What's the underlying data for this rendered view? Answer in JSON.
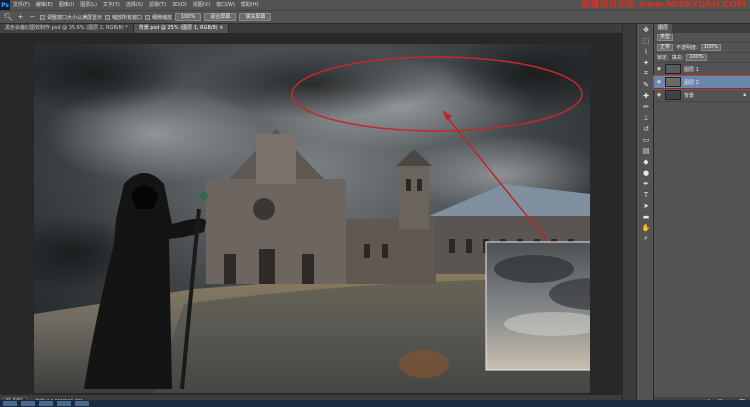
{
  "app": {
    "logo": "Ps"
  },
  "menu": [
    "文件(F)",
    "编辑(E)",
    "图像(I)",
    "图层(L)",
    "文字(Y)",
    "选择(S)",
    "滤镜(T)",
    "3D(D)",
    "视图(V)",
    "窗口(W)",
    "帮助(H)"
  ],
  "watermark": {
    "brand": "思缘设计论坛",
    "site": "www.MISSYUAN.COM"
  },
  "options": {
    "zoom_in_icon": "zoom-in-icon",
    "zoom_out_icon": "zoom-out-icon",
    "resize_windows": "调整窗口大小以满屏显示",
    "zoom_all_windows": "缩放所有窗口",
    "scrubby_zoom": "细微缩放",
    "btn_100": "100%",
    "btn_fit": "适合屏幕",
    "btn_fill": "填充屏幕"
  },
  "tabs": [
    "黑色会魔幻图效制作.psd @ 35.6% (图层 2, RGB/8) *",
    "背景.psd @ 25% (图层 1, RGB/8) ×"
  ],
  "status": {
    "zoom": "35.58%",
    "doc": "文档:24.9M/166.9M"
  },
  "layers_panel": {
    "tabs": [
      "图层"
    ],
    "kind_label": "类型",
    "blend_mode": "正常",
    "opacity_label": "不透明度:",
    "opacity_value": "100%",
    "lock_label": "锁定:",
    "fill_label": "填充:",
    "fill_value": "100%",
    "layers": [
      {
        "name": "图层 1",
        "selected": false
      },
      {
        "name": "图层 2",
        "selected": true
      },
      {
        "name": "背景",
        "selected": false
      }
    ]
  },
  "colors": {
    "accent_red": "#c42a2a",
    "selection_blue": "#6b87ad"
  }
}
